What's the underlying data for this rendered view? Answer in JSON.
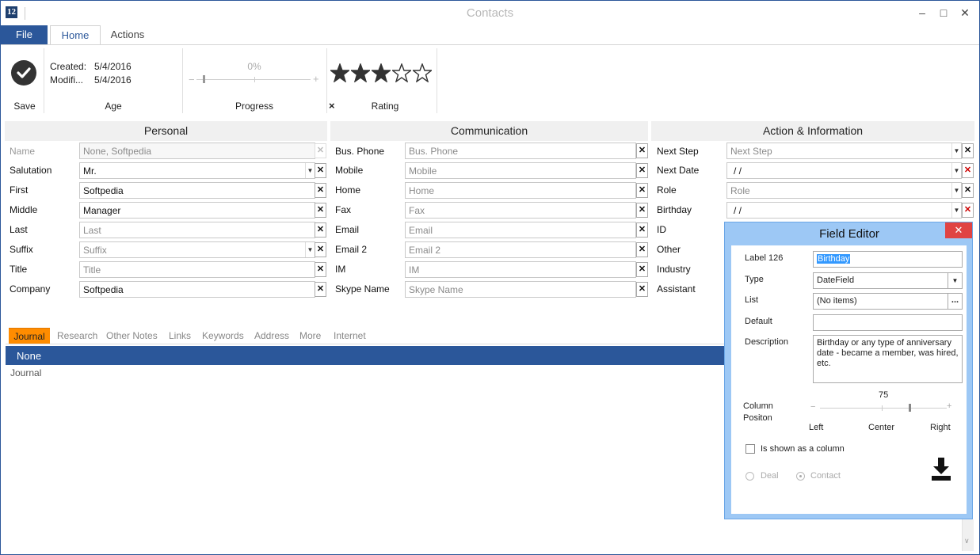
{
  "window": {
    "title": "Contacts",
    "app_icon_text": "12"
  },
  "ribbon": {
    "tabs": {
      "file": "File",
      "home": "Home",
      "actions": "Actions"
    },
    "save_label": "Save",
    "age": {
      "created_label": "Created:",
      "created_value": "5/4/2016",
      "modified_label": "Modifi...",
      "modified_value": "5/4/2016",
      "group_label": "Age"
    },
    "progress": {
      "value_text": "0%",
      "value": 0,
      "group_label": "Progress"
    },
    "rating": {
      "stars": 3,
      "max": 5,
      "group_label": "Rating",
      "clear": "×"
    }
  },
  "sections": {
    "personal": "Personal",
    "communication": "Communication",
    "action": "Action & Information"
  },
  "personal": {
    "name": {
      "label": "Name",
      "value": "None, Softpedia"
    },
    "salutation": {
      "label": "Salutation",
      "value": "Mr."
    },
    "first": {
      "label": "First",
      "value": "Softpedia"
    },
    "middle": {
      "label": "Middle",
      "value": "Manager"
    },
    "last": {
      "label": "Last",
      "placeholder": "Last"
    },
    "suffix": {
      "label": "Suffix",
      "placeholder": "Suffix"
    },
    "title": {
      "label": "Title",
      "placeholder": "Title"
    },
    "company": {
      "label": "Company",
      "value": "Softpedia"
    }
  },
  "communication": {
    "bus_phone": {
      "label": "Bus. Phone",
      "placeholder": "Bus. Phone"
    },
    "mobile": {
      "label": "Mobile",
      "placeholder": "Mobile"
    },
    "home": {
      "label": "Home",
      "placeholder": "Home"
    },
    "fax": {
      "label": "Fax",
      "placeholder": "Fax"
    },
    "email": {
      "label": "Email",
      "placeholder": "Email"
    },
    "email2": {
      "label": "Email 2",
      "placeholder": "Email 2"
    },
    "im": {
      "label": "IM",
      "placeholder": "IM"
    },
    "skype": {
      "label": "Skype Name",
      "placeholder": "Skype Name"
    }
  },
  "action": {
    "next_step": {
      "label": "Next Step",
      "placeholder": "Next Step"
    },
    "next_date": {
      "label": "Next Date",
      "value": "/     /"
    },
    "role": {
      "label": "Role",
      "placeholder": "Role"
    },
    "birthday": {
      "label": "Birthday",
      "value": "/     /"
    },
    "id": {
      "label": "ID"
    },
    "other": {
      "label": "Other"
    },
    "industry": {
      "label": "Industry"
    },
    "assistant": {
      "label": "Assistant"
    }
  },
  "lower_tabs": [
    "Journal",
    "Research",
    "Other Notes",
    "Links",
    "Keywords",
    "Address",
    "More",
    "Internet"
  ],
  "journal": {
    "selected": "None",
    "text": "Journal"
  },
  "field_editor": {
    "title": "Field Editor",
    "label_label": "Label 126",
    "label_value": "Birthday",
    "type_label": "Type",
    "type_value": "DateField",
    "list_label": "List",
    "list_value": "(No items)",
    "list_button": "...",
    "default_label": "Default",
    "description_label": "Description",
    "description_value": "Birthday or any type of anniversary date - became a member, was hired, etc.",
    "column_position_label_1": "Column",
    "column_position_label_2": "Positon",
    "column_position_value": "75",
    "slider_left": "Left",
    "slider_center": "Center",
    "slider_right": "Right",
    "shown_as_column": "Is shown as a column",
    "radio_deal": "Deal",
    "radio_contact": "Contact",
    "close": "✕"
  },
  "colors": {
    "accent": "#2b579a",
    "journal_tab": "#ff8c00",
    "dialog_bg": "#9dc8f5",
    "close_red": "#e04343"
  }
}
